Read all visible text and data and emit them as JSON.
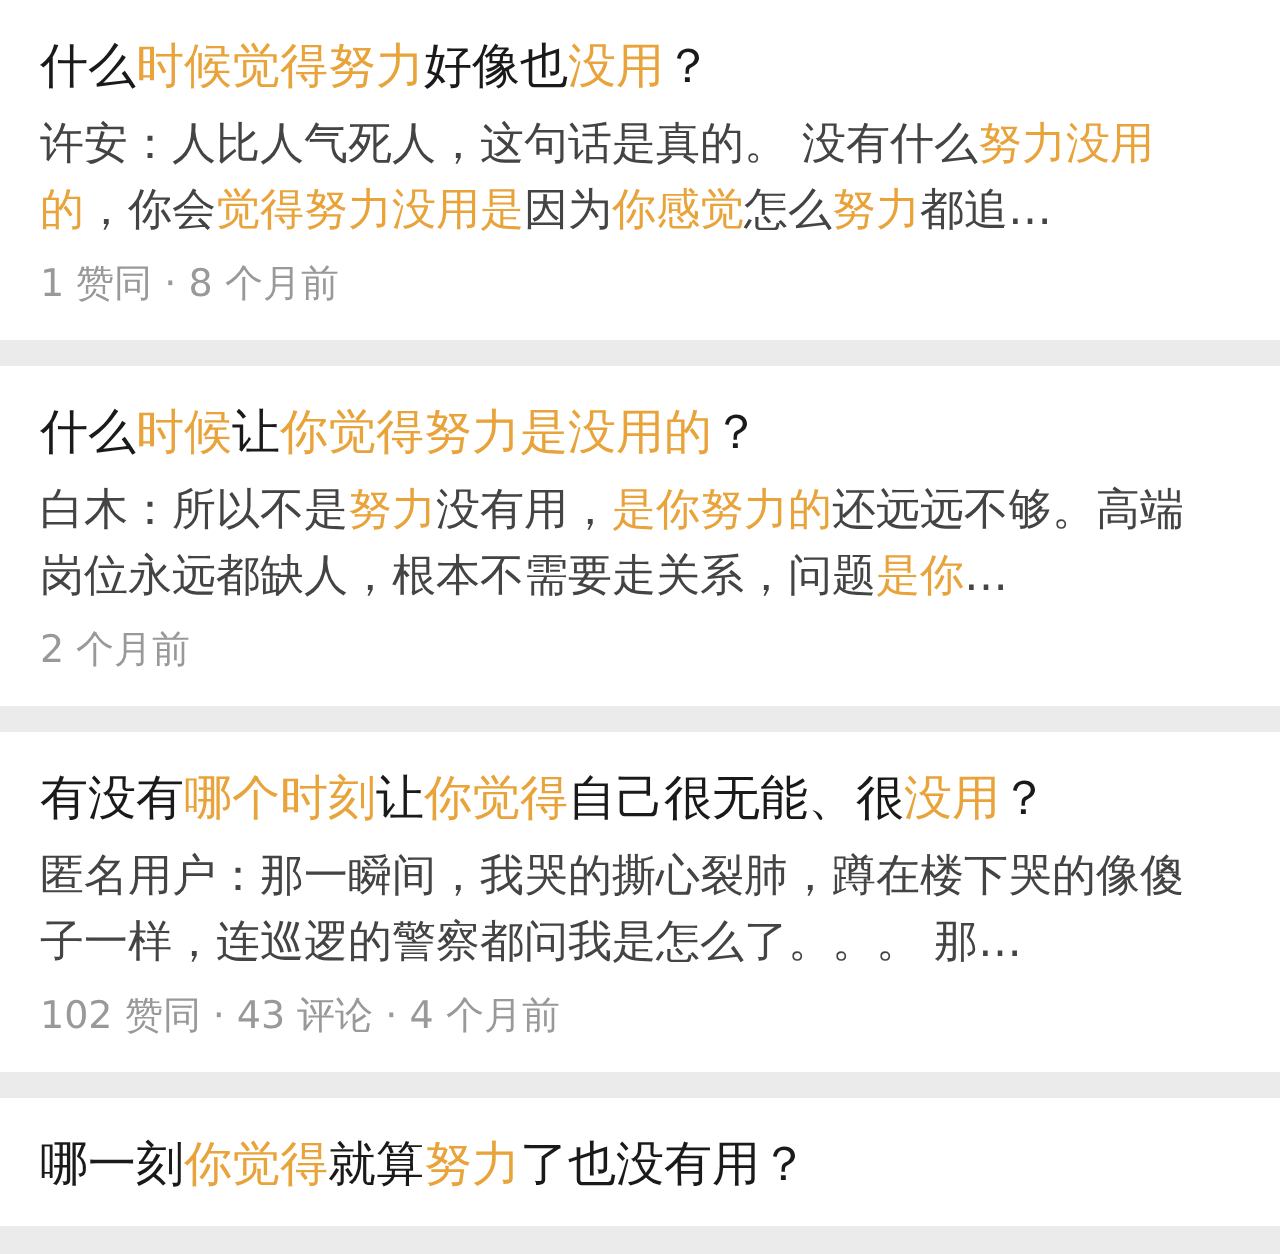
{
  "results": [
    {
      "title": [
        {
          "text": "什么",
          "highlight": false
        },
        {
          "text": "时候觉得努力",
          "highlight": true
        },
        {
          "text": "好像也",
          "highlight": false
        },
        {
          "text": "没用",
          "highlight": true
        },
        {
          "text": "？",
          "highlight": false
        }
      ],
      "excerpt": [
        {
          "text": "许安：人比人气死人，这句话是真的。 没有什么",
          "highlight": false
        },
        {
          "text": "努力没用的",
          "highlight": true
        },
        {
          "text": "，你会",
          "highlight": false
        },
        {
          "text": "觉得努力没用是",
          "highlight": true
        },
        {
          "text": "因为",
          "highlight": false
        },
        {
          "text": "你感觉",
          "highlight": true
        },
        {
          "text": "怎么",
          "highlight": false
        },
        {
          "text": "努力",
          "highlight": true
        },
        {
          "text": "都追…",
          "highlight": false
        }
      ],
      "meta": "1 赞同 · 8 个月前"
    },
    {
      "title": [
        {
          "text": "什么",
          "highlight": false
        },
        {
          "text": "时候",
          "highlight": true
        },
        {
          "text": "让",
          "highlight": false
        },
        {
          "text": "你觉得努力是没用的",
          "highlight": true
        },
        {
          "text": "？",
          "highlight": false
        }
      ],
      "excerpt": [
        {
          "text": "白木：所以不是",
          "highlight": false
        },
        {
          "text": "努力",
          "highlight": true
        },
        {
          "text": "没有用，",
          "highlight": false
        },
        {
          "text": "是你努力的",
          "highlight": true
        },
        {
          "text": "还远远不够。高端岗位永远都缺人，根本不需要走关系，问题",
          "highlight": false
        },
        {
          "text": "是你",
          "highlight": true
        },
        {
          "text": "…",
          "highlight": false
        }
      ],
      "meta": "2 个月前"
    },
    {
      "title": [
        {
          "text": "有没有",
          "highlight": false
        },
        {
          "text": "哪个时刻",
          "highlight": true
        },
        {
          "text": "让",
          "highlight": false
        },
        {
          "text": "你觉得",
          "highlight": true
        },
        {
          "text": "自己很无能、很",
          "highlight": false
        },
        {
          "text": "没用",
          "highlight": true
        },
        {
          "text": "？",
          "highlight": false
        }
      ],
      "excerpt": [
        {
          "text": "匿名用户：那一瞬间，我哭的撕心裂肺，蹲在楼下哭的像傻子一样，连巡逻的警察都问我是怎么了。。。 那…",
          "highlight": false
        }
      ],
      "meta": "102 赞同 · 43 评论 · 4 个月前"
    },
    {
      "title": [
        {
          "text": "哪一刻",
          "highlight": false
        },
        {
          "text": "你觉得",
          "highlight": true
        },
        {
          "text": "就算",
          "highlight": false
        },
        {
          "text": "努力",
          "highlight": true
        },
        {
          "text": "了也没有用？",
          "highlight": false
        }
      ]
    }
  ]
}
